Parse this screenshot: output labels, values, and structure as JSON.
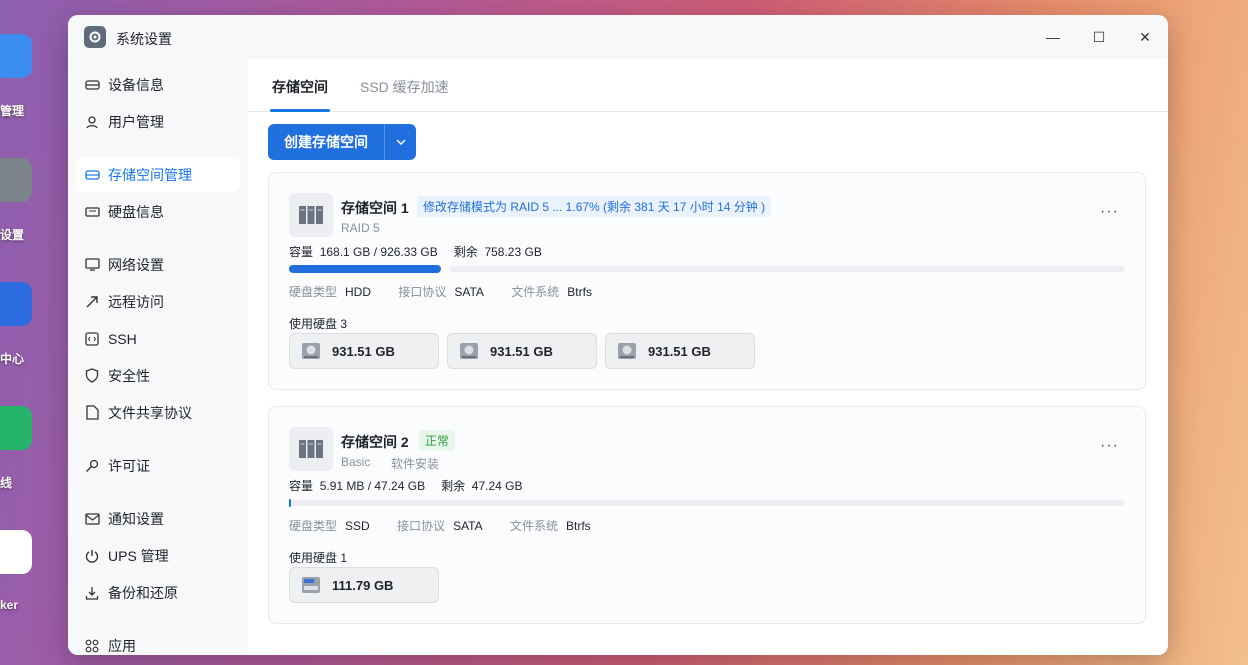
{
  "desktop": {
    "labels": [
      "管理",
      "设置",
      "中心",
      "线",
      "ker"
    ]
  },
  "window": {
    "title": "系统设置",
    "controls": {
      "minimize": "—",
      "maximize": "☐",
      "close": "✕"
    }
  },
  "sidebar": {
    "items": [
      {
        "label": "设备信息",
        "icon": "device-icon"
      },
      {
        "label": "用户管理",
        "icon": "user-icon"
      },
      {
        "label": "存储空间管理",
        "icon": "storage-icon",
        "active": true
      },
      {
        "label": "硬盘信息",
        "icon": "disk-icon"
      },
      {
        "label": "网络设置",
        "icon": "network-icon"
      },
      {
        "label": "远程访问",
        "icon": "remote-icon"
      },
      {
        "label": "SSH",
        "icon": "ssh-icon"
      },
      {
        "label": "安全性",
        "icon": "shield-icon"
      },
      {
        "label": "文件共享协议",
        "icon": "file-share-icon"
      },
      {
        "label": "许可证",
        "icon": "key-icon"
      },
      {
        "label": "通知设置",
        "icon": "mail-icon"
      },
      {
        "label": "UPS 管理",
        "icon": "power-icon"
      },
      {
        "label": "备份和还原",
        "icon": "backup-icon"
      },
      {
        "label": "应用",
        "icon": "apps-icon"
      }
    ]
  },
  "tabs": [
    {
      "label": "存储空间",
      "active": true
    },
    {
      "label": "SSD 缓存加速",
      "active": false
    }
  ],
  "toolbar": {
    "create_label": "创建存储空间"
  },
  "pools": [
    {
      "name": "存储空间 1",
      "status": "修改存储模式为 RAID 5 ... 1.67% (剩余 381 天 17 小时 14 分钟 )",
      "sub1": "RAID 5",
      "sub2": "",
      "capacity_label": "容量",
      "capacity": "168.1 GB / 926.33 GB",
      "free_label": "剩余",
      "free": "758.23 GB",
      "usage_fraction": 0.18,
      "disk_type_label": "硬盘类型",
      "disk_type": "HDD",
      "interface_label": "接口协议",
      "interface": "SATA",
      "fs_label": "文件系统",
      "fs": "Btrfs",
      "used_disks_label": "使用硬盘 3",
      "disks": [
        "931.51 GB",
        "931.51 GB",
        "931.51 GB"
      ]
    },
    {
      "name": "存储空间 2",
      "status": "正常",
      "sub1": "Basic",
      "sub2": "软件安装",
      "capacity_label": "容量",
      "capacity": "5.91 MB / 47.24 GB",
      "free_label": "剩余",
      "free": "47.24 GB",
      "usage_fraction": 0.001,
      "disk_type_label": "硬盘类型",
      "disk_type": "SSD",
      "interface_label": "接口协议",
      "interface": "SATA",
      "fs_label": "文件系统",
      "fs": "Btrfs",
      "used_disks_label": "使用硬盘 1",
      "disks": [
        "111.79 GB"
      ]
    }
  ],
  "more_glyph": "···"
}
